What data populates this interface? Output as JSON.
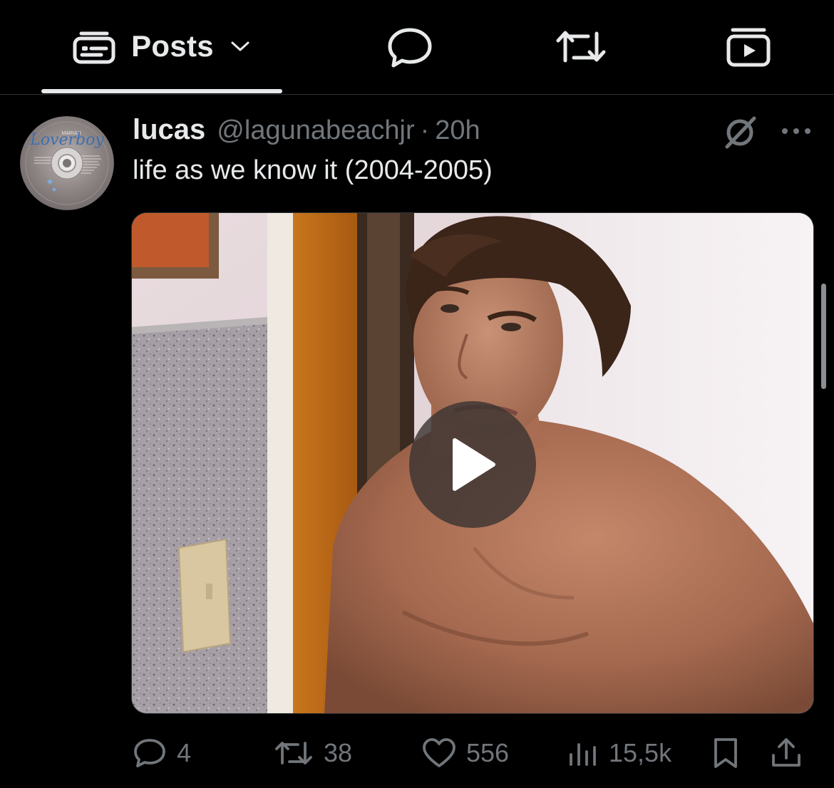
{
  "tabs": {
    "posts_label": "Posts",
    "posts_icon": "feed-icon",
    "dropdown_icon": "chevron-down-icon",
    "replies_icon": "speech-bubble-icon",
    "reposts_icon": "repost-icon",
    "videos_icon": "video-stack-icon",
    "active_tab": "Posts"
  },
  "post": {
    "display_name": "lucas",
    "handle": "@lagunabeachjr",
    "separator": "·",
    "time": "20h",
    "text": "life as we know it (2004-2005)",
    "avatar": {
      "description": "CD disc image",
      "album_title": "Loverboy",
      "artist": "MARIAH"
    },
    "media": {
      "type": "video",
      "play_icon": "play-icon"
    },
    "actions": {
      "replies": "4",
      "reposts": "38",
      "likes": "556",
      "views": "15,5k"
    }
  },
  "colors": {
    "background": "#000000",
    "text_primary": "#e7e9ea",
    "text_secondary": "#71767b",
    "divider": "#2f3336"
  }
}
